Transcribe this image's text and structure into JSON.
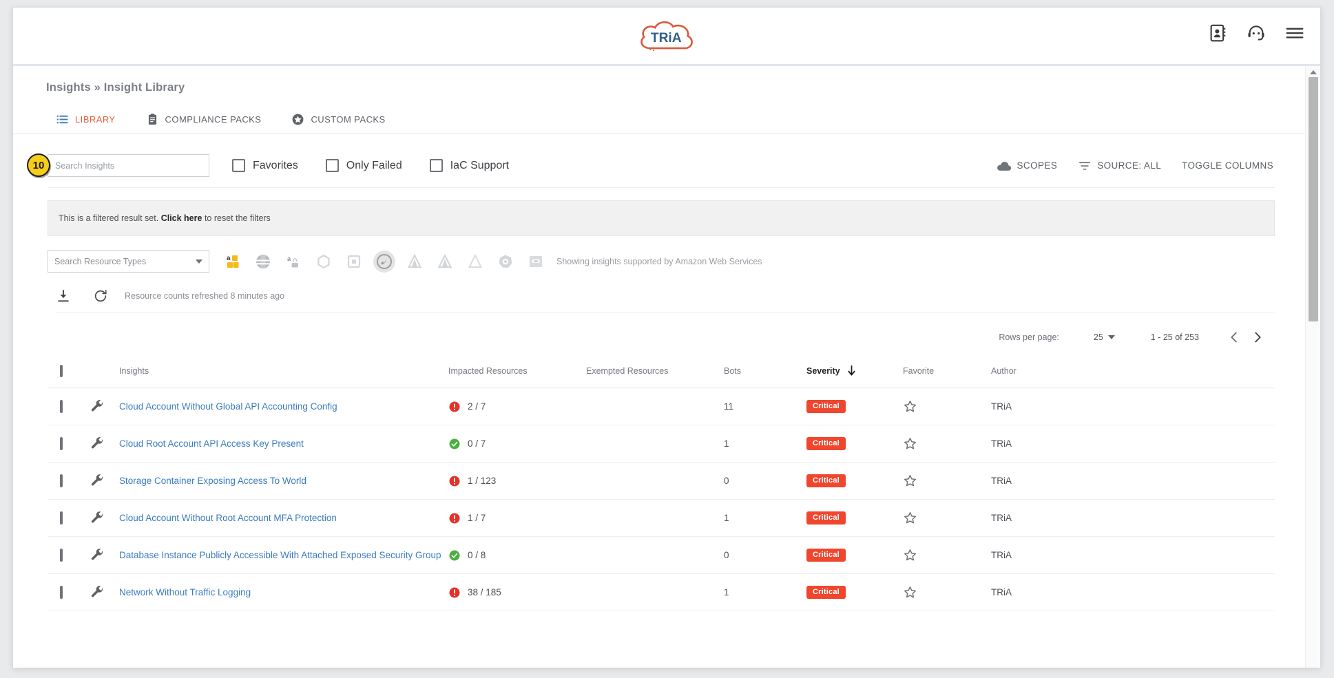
{
  "app": {
    "logo_text": "TRiA",
    "header_icons": [
      {
        "name": "contacts-icon",
        "title": "Contacts"
      },
      {
        "name": "support-headset-icon",
        "title": "Support"
      },
      {
        "name": "hamburger-menu-icon",
        "title": "Menu"
      }
    ]
  },
  "breadcrumb": {
    "text": "Insights » Insight Library"
  },
  "tabs": [
    {
      "label": "LIBRARY",
      "icon": "list-icon",
      "active": true
    },
    {
      "label": "COMPLIANCE PACKS",
      "icon": "clipboard-icon",
      "active": false
    },
    {
      "label": "CUSTOM PACKS",
      "icon": "star-circle-icon",
      "active": false
    }
  ],
  "toolbar": {
    "step_badge": "10",
    "search_placeholder": "Search Insights",
    "search_value": "",
    "checkboxes": [
      {
        "label": "Favorites",
        "checked": false
      },
      {
        "label": "Only Failed",
        "checked": false
      },
      {
        "label": "IaC Support",
        "checked": false
      }
    ],
    "actions": [
      {
        "label": "SCOPES",
        "icon": "cloud-icon"
      },
      {
        "label": "SOURCE: ALL",
        "icon": "filter-icon"
      },
      {
        "label": "TOGGLE COLUMNS",
        "icon": "none"
      }
    ]
  },
  "notice": {
    "prefix": "This is a filtered result set.",
    "link": "Click here",
    "suffix": "to reset the filters"
  },
  "resource_types": {
    "select_placeholder": "Search Resource Types",
    "providers": [
      {
        "name": "aws-cubes-icon",
        "selected": false
      },
      {
        "name": "openstack-icon",
        "selected": false
      },
      {
        "name": "alibaba-cloud-icon",
        "selected": false
      },
      {
        "name": "hexagon-provider-icon",
        "selected": false
      },
      {
        "name": "square-provider-icon",
        "selected": false
      },
      {
        "name": "amazon-web-services-icon",
        "selected": true
      },
      {
        "name": "azure-icon",
        "selected": false
      },
      {
        "name": "azure-gov-icon",
        "selected": false
      },
      {
        "name": "azure-stack-icon",
        "selected": false
      },
      {
        "name": "kubernetes-icon",
        "selected": false
      },
      {
        "name": "container-icon",
        "selected": false
      }
    ],
    "note": "Showing insights supported by Amazon Web Services"
  },
  "refresh_row": {
    "download_title": "Download",
    "refresh_title": "Refresh",
    "text": "Resource counts refreshed 8 minutes ago"
  },
  "pagination": {
    "rows_per_page_label": "Rows per page:",
    "rows_per_page_value": "25",
    "range": "1 - 25 of 253",
    "prev_label": "‹",
    "next_label": "›"
  },
  "table": {
    "columns": [
      {
        "key": "insights",
        "label": "Insights",
        "sorted": false
      },
      {
        "key": "impacted",
        "label": "Impacted Resources",
        "sorted": false
      },
      {
        "key": "exempted",
        "label": "Exempted Resources",
        "sorted": false
      },
      {
        "key": "bots",
        "label": "Bots",
        "sorted": false
      },
      {
        "key": "severity",
        "label": "Severity",
        "sorted": true,
        "sort_dir": "desc"
      },
      {
        "key": "favorite",
        "label": "Favorite",
        "sorted": false
      },
      {
        "key": "author",
        "label": "Author",
        "sorted": false
      }
    ],
    "rows": [
      {
        "name": "Cloud Account Without Global API Accounting Config",
        "impacted": "2 / 7",
        "impacted_status": "fail",
        "exempted": "",
        "bots": "11",
        "severity": "Critical",
        "favorite": false,
        "author": "TRiA"
      },
      {
        "name": "Cloud Root Account API Access Key Present",
        "impacted": "0 / 7",
        "impacted_status": "pass",
        "exempted": "",
        "bots": "1",
        "severity": "Critical",
        "favorite": false,
        "author": "TRiA"
      },
      {
        "name": "Storage Container Exposing Access To World",
        "impacted": "1 / 123",
        "impacted_status": "fail",
        "exempted": "",
        "bots": "0",
        "severity": "Critical",
        "favorite": false,
        "author": "TRiA"
      },
      {
        "name": "Cloud Account Without Root Account MFA Protection",
        "impacted": "1 / 7",
        "impacted_status": "fail",
        "exempted": "",
        "bots": "1",
        "severity": "Critical",
        "favorite": false,
        "author": "TRiA"
      },
      {
        "name": "Database Instance Publicly Accessible With Attached Exposed Security Group",
        "impacted": "0 / 8",
        "impacted_status": "pass",
        "exempted": "",
        "bots": "0",
        "severity": "Critical",
        "favorite": false,
        "author": "TRiA"
      },
      {
        "name": "Network Without Traffic Logging",
        "impacted": "38 / 185",
        "impacted_status": "fail",
        "exempted": "",
        "bots": "1",
        "severity": "Critical",
        "favorite": false,
        "author": "TRiA"
      }
    ]
  },
  "colors": {
    "accent_orange": "#ec5b3c",
    "link_blue": "#3a7bbf",
    "critical_red": "#f0462d",
    "fail_red": "#e53128",
    "pass_green": "#4caf3f",
    "badge_yellow": "#f5cd1a",
    "logo_cloud": "#d9593c",
    "logo_text": "#2d5f8a"
  }
}
